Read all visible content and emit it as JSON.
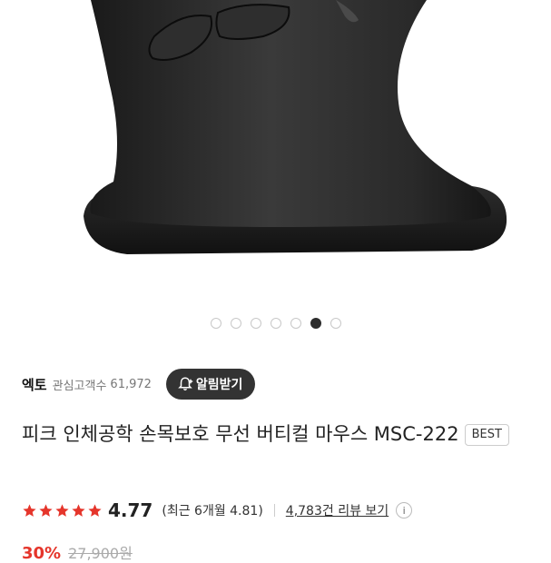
{
  "gallery": {
    "image_alt": "black vertical ergonomic mouse",
    "dot_count": 7,
    "active_index": 5
  },
  "seller": {
    "brand": "엑토",
    "fans_label": "관심고객수",
    "fans_count": "61,972",
    "alert_button": "알림받기"
  },
  "product": {
    "title": "피크 인체공학 손목보호 무선 버티컬 마우스 MSC-222",
    "badge": "BEST"
  },
  "rating": {
    "stars": 5,
    "score": "4.77",
    "recent": "(최근 6개월 4.81)",
    "reviews_link": "4,783건 리뷰 보기",
    "info": "i"
  },
  "price": {
    "discount": "30%",
    "original": "27,900원"
  },
  "colors": {
    "star": "#e5352b",
    "discount": "#e5352b",
    "alert_bg": "#333333"
  }
}
